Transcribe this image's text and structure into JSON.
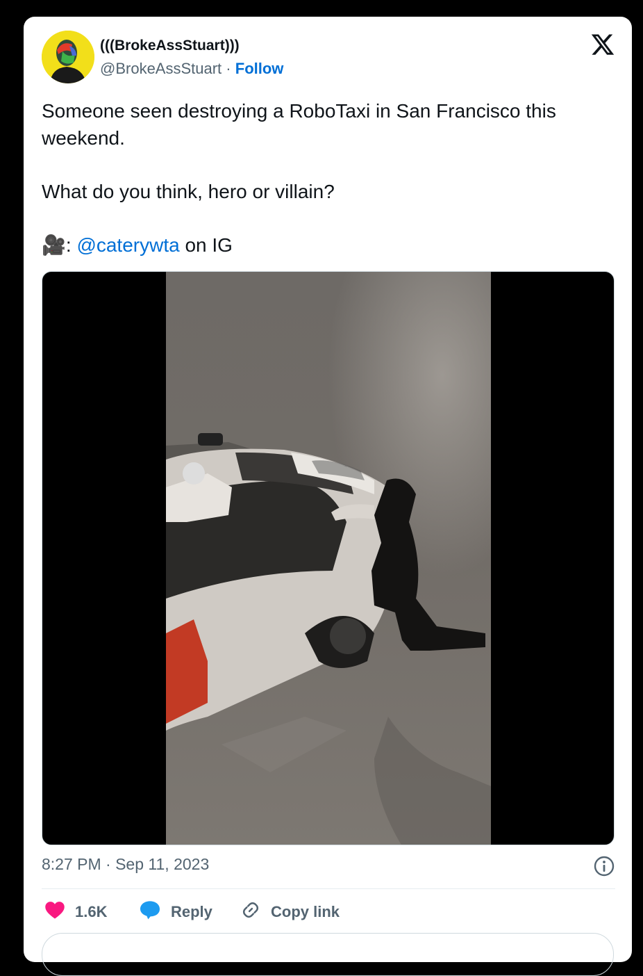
{
  "tweet": {
    "display_name": "(((BrokeAssStuart)))",
    "handle": "@BrokeAssStuart",
    "separator": " · ",
    "follow_label": "Follow",
    "text_line1": "Someone seen destroying a RoboTaxi in San Francisco this weekend.",
    "text_line2": "What do you think, hero or villain?",
    "credit_emoji": "🎥",
    "credit_colon": ": ",
    "credit_mention": "@caterywta",
    "credit_suffix": " on IG",
    "timestamp": "8:27 PM · Sep 11, 2023"
  },
  "actions": {
    "like_count": "1.6K",
    "reply_label": "Reply",
    "copy_label": "Copy link"
  },
  "colors": {
    "link": "#006fd6",
    "like": "#f91880",
    "reply": "#1d9bf0",
    "secondary_text": "#536471"
  },
  "icons": [
    "x-logo-icon",
    "info-icon",
    "heart-icon",
    "reply-bubble-icon",
    "link-icon"
  ]
}
